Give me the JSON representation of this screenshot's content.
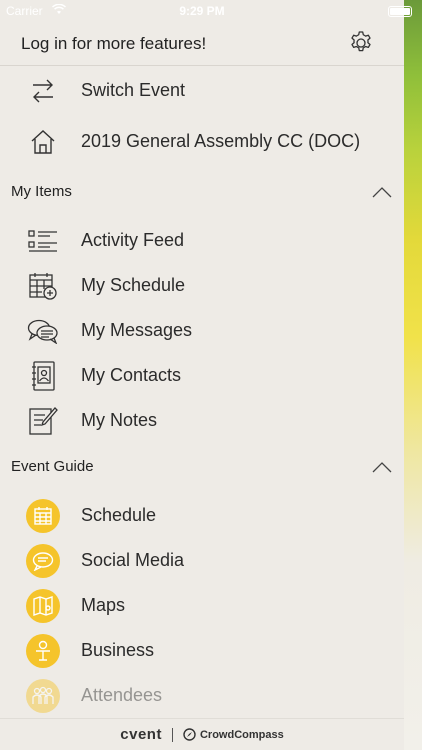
{
  "status_bar": {
    "carrier": "Carrier",
    "time": "9:29 PM"
  },
  "header": {
    "login_text": "Log in for more features!",
    "settings_icon": "gear-icon"
  },
  "top_items": [
    {
      "label": "Switch Event",
      "icon": "swap-arrows-icon"
    },
    {
      "label": "2019 General Assembly CC (DOC)",
      "icon": "home-icon"
    }
  ],
  "my_items": {
    "title": "My Items",
    "items": [
      {
        "label": "Activity Feed",
        "icon": "list-icon"
      },
      {
        "label": "My Schedule",
        "icon": "calendar-add-icon"
      },
      {
        "label": "My Messages",
        "icon": "chat-bubbles-icon"
      },
      {
        "label": "My Contacts",
        "icon": "contact-book-icon"
      },
      {
        "label": "My Notes",
        "icon": "notepad-icon"
      }
    ]
  },
  "event_guide": {
    "title": "Event Guide",
    "items": [
      {
        "label": "Schedule",
        "icon": "calendar-icon"
      },
      {
        "label": "Social Media",
        "icon": "chat-icon"
      },
      {
        "label": "Maps",
        "icon": "map-icon"
      },
      {
        "label": "Business",
        "icon": "presenter-icon"
      },
      {
        "label": "Attendees",
        "icon": "people-icon"
      }
    ]
  },
  "footer": {
    "brand1": "cvent",
    "brand2": "CrowdCompass"
  },
  "colors": {
    "background": "#eeebe6",
    "accent_yellow": "#f5c42b"
  }
}
